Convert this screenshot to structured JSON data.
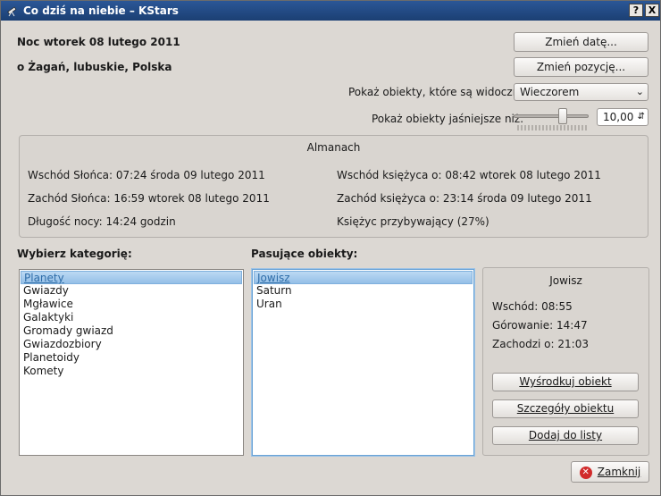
{
  "window": {
    "title": "Co dziś na niebie – KStars",
    "help_button": "?",
    "close_button": "X"
  },
  "header": {
    "date_label": "Noc wtorek 08 lutego 2011",
    "location_label": "o Żagań, lubuskie, Polska",
    "change_date_button": "Zmień datę...",
    "change_location_button": "Zmień pozycję..."
  },
  "filters": {
    "visible_label": "Pokaż obiekty, które są widoczne:",
    "visible_value": "Wieczorem",
    "brighter_label": "Pokaż obiekty jaśniejsze niż:",
    "magnitude_value": "10,00"
  },
  "almanac": {
    "title": "Almanach",
    "sunrise": "Wschód Słońca: 07:24 środa 09 lutego 2011",
    "sunset": "Zachód Słońca: 16:59 wtorek 08 lutego 2011",
    "night_length": "Długość nocy: 14:24 godzin",
    "moonrise": "Wschód księżyca o: 08:42 wtorek 08 lutego 2011",
    "moonset": "Zachód księżyca o: 23:14 środa 09 lutego 2011",
    "moon_phase": "Księżyc przybywający (27%)"
  },
  "categories": {
    "heading": "Wybierz kategorię:",
    "items": [
      "Planety",
      "Gwiazdy",
      "Mgławice",
      "Galaktyki",
      "Gromady gwiazd",
      "Gwiazdozbiory",
      "Planetoidy",
      "Komety"
    ]
  },
  "objects": {
    "heading": "Pasujące obiekty:",
    "items": [
      "Jowisz",
      "Saturn",
      "Uran"
    ]
  },
  "details": {
    "name": "Jowisz",
    "rise": "Wschód: 08:55",
    "transit": "Górowanie: 14:47",
    "set": "Zachodzi o: 21:03",
    "center_button": "Wyśrodkuj obiekt",
    "details_button": "Szczegóły obiektu",
    "add_button": "Dodaj do listy"
  },
  "footer": {
    "close_button": "Zamknij"
  },
  "colors": {
    "titlebar": "#2b5797",
    "selection": "#94bfe7"
  },
  "icons": {
    "app": "telescope-icon",
    "close": "close-icon"
  }
}
